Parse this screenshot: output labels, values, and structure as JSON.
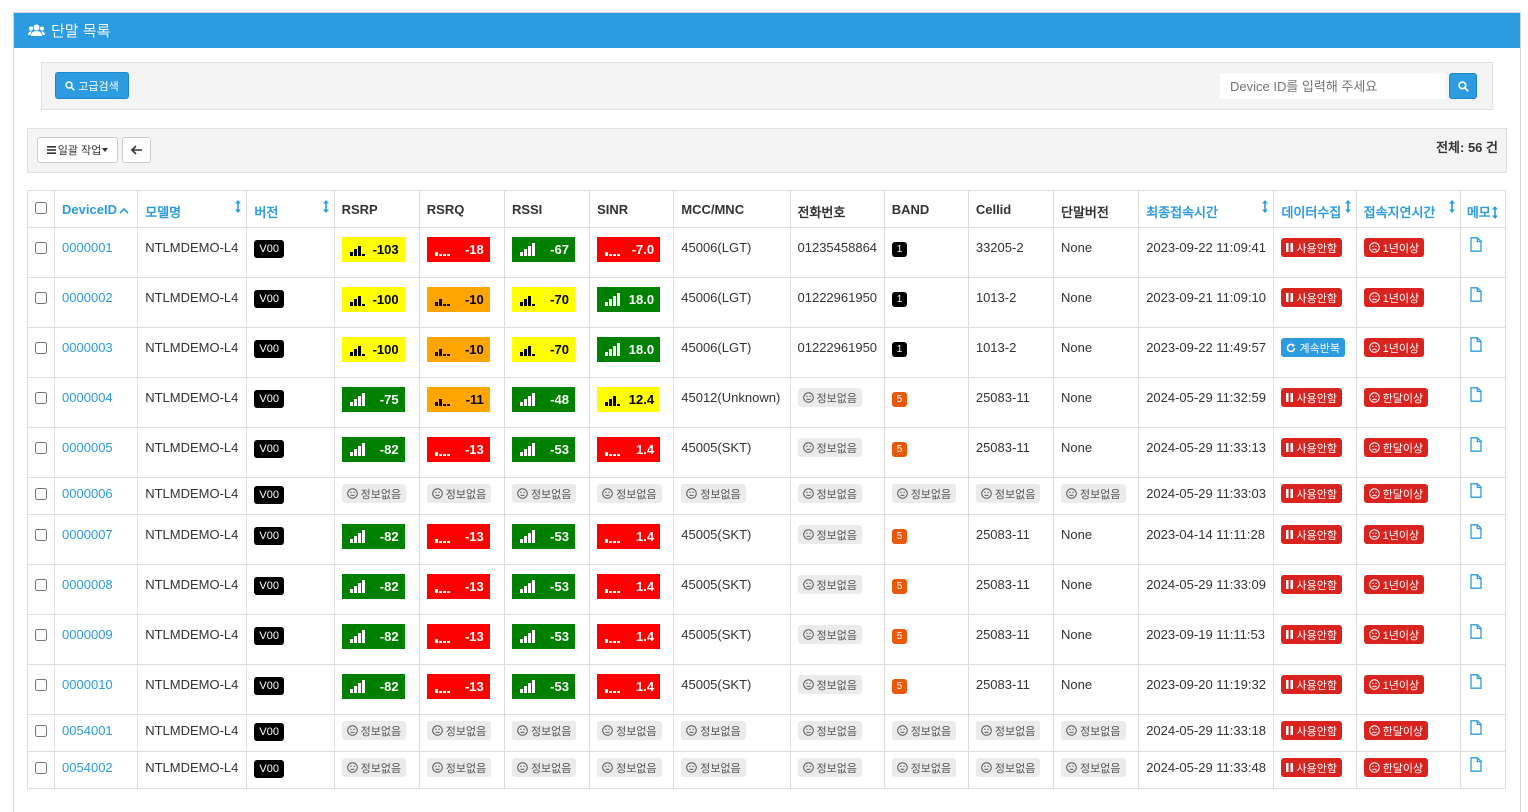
{
  "panel_title": "단말 목록",
  "search": {
    "advanced_label": "고급검색",
    "placeholder": "Device ID를 입력해 주세요"
  },
  "toolbar": {
    "bulk_label": "일괄 작업",
    "total_text": "전체: 56 건"
  },
  "columns": [
    "DeviceID",
    "모델명",
    "버전",
    "RSRP",
    "RSRQ",
    "RSSI",
    "SINR",
    "MCC/MNC",
    "전화번호",
    "BAND",
    "Cellid",
    "단말버전",
    "최종접속시간",
    "데이터수집",
    "접속지연시간",
    "메모"
  ],
  "no_info_label": "정보없음",
  "colors": {
    "header": "#2d9be0",
    "green": "#008000",
    "red": "#ff0000",
    "yellow": "#ffff00",
    "orange": "#ffa500",
    "label_red": "#d9231f"
  },
  "rows": [
    {
      "id": "0000001",
      "model": "NTLMDEMO-L4",
      "ver": "V00",
      "rsrp": {
        "v": "-103",
        "c": "yellow",
        "b": 3
      },
      "rsrq": {
        "v": "-18",
        "c": "red",
        "b": 1
      },
      "rssi": {
        "v": "-67",
        "c": "green",
        "b": 4
      },
      "sinr": {
        "v": "-7.0",
        "c": "red",
        "b": 1
      },
      "mcc": "45006(LGT)",
      "phone": "01235458864",
      "band": "1",
      "cellid": "33205-2",
      "fw": "None",
      "last": "2023-09-22 11:09:41",
      "collect": "사용안함",
      "collect_type": "pause",
      "delay": "1년이상"
    },
    {
      "id": "0000002",
      "model": "NTLMDEMO-L4",
      "ver": "V00",
      "rsrp": {
        "v": "-100",
        "c": "yellow",
        "b": 3
      },
      "rsrq": {
        "v": "-10",
        "c": "orange",
        "b": 2
      },
      "rssi": {
        "v": "-70",
        "c": "yellow",
        "b": 3
      },
      "sinr": {
        "v": "18.0",
        "c": "green",
        "b": 4
      },
      "mcc": "45006(LGT)",
      "phone": "01222961950",
      "band": "1",
      "cellid": "1013-2",
      "fw": "None",
      "last": "2023-09-21 11:09:10",
      "collect": "사용안함",
      "collect_type": "pause",
      "delay": "1년이상"
    },
    {
      "id": "0000003",
      "model": "NTLMDEMO-L4",
      "ver": "V00",
      "rsrp": {
        "v": "-100",
        "c": "yellow",
        "b": 3
      },
      "rsrq": {
        "v": "-10",
        "c": "orange",
        "b": 2
      },
      "rssi": {
        "v": "-70",
        "c": "yellow",
        "b": 3
      },
      "sinr": {
        "v": "18.0",
        "c": "green",
        "b": 4
      },
      "mcc": "45006(LGT)",
      "phone": "01222961950",
      "band": "1",
      "cellid": "1013-2",
      "fw": "None",
      "last": "2023-09-22 11:49:57",
      "collect": "계속반복",
      "collect_type": "repeat",
      "delay": "1년이상"
    },
    {
      "id": "0000004",
      "model": "NTLMDEMO-L4",
      "ver": "V00",
      "rsrp": {
        "v": "-75",
        "c": "green",
        "b": 4
      },
      "rsrq": {
        "v": "-11",
        "c": "orange",
        "b": 2
      },
      "rssi": {
        "v": "-48",
        "c": "green",
        "b": 4
      },
      "sinr": {
        "v": "12.4",
        "c": "yellow",
        "b": 3
      },
      "mcc": "45012(Unknown)",
      "phone": null,
      "band": "5",
      "cellid": "25083-11",
      "fw": "None",
      "last": "2024-05-29 11:32:59",
      "collect": "사용안함",
      "collect_type": "pause",
      "delay": "한달이상"
    },
    {
      "id": "0000005",
      "model": "NTLMDEMO-L4",
      "ver": "V00",
      "rsrp": {
        "v": "-82",
        "c": "green",
        "b": 4
      },
      "rsrq": {
        "v": "-13",
        "c": "red",
        "b": 1
      },
      "rssi": {
        "v": "-53",
        "c": "green",
        "b": 4
      },
      "sinr": {
        "v": "1.4",
        "c": "red",
        "b": 1
      },
      "mcc": "45005(SKT)",
      "phone": null,
      "band": "5",
      "cellid": "25083-11",
      "fw": "None",
      "last": "2024-05-29 11:33:13",
      "collect": "사용안함",
      "collect_type": "pause",
      "delay": "한달이상"
    },
    {
      "id": "0000006",
      "model": "NTLMDEMO-L4",
      "ver": "V00",
      "rsrp": null,
      "rsrq": null,
      "rssi": null,
      "sinr": null,
      "mcc": null,
      "phone": null,
      "band": null,
      "cellid": null,
      "fw": null,
      "last": "2024-05-29 11:33:03",
      "collect": "사용안함",
      "collect_type": "pause",
      "delay": "한달이상"
    },
    {
      "id": "0000007",
      "model": "NTLMDEMO-L4",
      "ver": "V00",
      "rsrp": {
        "v": "-82",
        "c": "green",
        "b": 4
      },
      "rsrq": {
        "v": "-13",
        "c": "red",
        "b": 1
      },
      "rssi": {
        "v": "-53",
        "c": "green",
        "b": 4
      },
      "sinr": {
        "v": "1.4",
        "c": "red",
        "b": 1
      },
      "mcc": "45005(SKT)",
      "phone": null,
      "band": "5",
      "cellid": "25083-11",
      "fw": "None",
      "last": "2023-04-14 11:11:28",
      "collect": "사용안함",
      "collect_type": "pause",
      "delay": "1년이상"
    },
    {
      "id": "0000008",
      "model": "NTLMDEMO-L4",
      "ver": "V00",
      "rsrp": {
        "v": "-82",
        "c": "green",
        "b": 4
      },
      "rsrq": {
        "v": "-13",
        "c": "red",
        "b": 1
      },
      "rssi": {
        "v": "-53",
        "c": "green",
        "b": 4
      },
      "sinr": {
        "v": "1.4",
        "c": "red",
        "b": 1
      },
      "mcc": "45005(SKT)",
      "phone": null,
      "band": "5",
      "cellid": "25083-11",
      "fw": "None",
      "last": "2024-05-29 11:33:09",
      "collect": "사용안함",
      "collect_type": "pause",
      "delay": "1년이상"
    },
    {
      "id": "0000009",
      "model": "NTLMDEMO-L4",
      "ver": "V00",
      "rsrp": {
        "v": "-82",
        "c": "green",
        "b": 4
      },
      "rsrq": {
        "v": "-13",
        "c": "red",
        "b": 1
      },
      "rssi": {
        "v": "-53",
        "c": "green",
        "b": 4
      },
      "sinr": {
        "v": "1.4",
        "c": "red",
        "b": 1
      },
      "mcc": "45005(SKT)",
      "phone": null,
      "band": "5",
      "cellid": "25083-11",
      "fw": "None",
      "last": "2023-09-19 11:11:53",
      "collect": "사용안함",
      "collect_type": "pause",
      "delay": "1년이상"
    },
    {
      "id": "0000010",
      "model": "NTLMDEMO-L4",
      "ver": "V00",
      "rsrp": {
        "v": "-82",
        "c": "green",
        "b": 4
      },
      "rsrq": {
        "v": "-13",
        "c": "red",
        "b": 1
      },
      "rssi": {
        "v": "-53",
        "c": "green",
        "b": 4
      },
      "sinr": {
        "v": "1.4",
        "c": "red",
        "b": 1
      },
      "mcc": "45005(SKT)",
      "phone": null,
      "band": "5",
      "cellid": "25083-11",
      "fw": "None",
      "last": "2023-09-20 11:19:32",
      "collect": "사용안함",
      "collect_type": "pause",
      "delay": "1년이상"
    },
    {
      "id": "0054001",
      "model": "NTLMDEMO-L4",
      "ver": "V00",
      "rsrp": null,
      "rsrq": null,
      "rssi": null,
      "sinr": null,
      "mcc": null,
      "phone": null,
      "band": null,
      "cellid": null,
      "fw": null,
      "last": "2024-05-29 11:33:18",
      "collect": "사용안함",
      "collect_type": "pause",
      "delay": "한달이상"
    },
    {
      "id": "0054002",
      "model": "NTLMDEMO-L4",
      "ver": "V00",
      "rsrp": null,
      "rsrq": null,
      "rssi": null,
      "sinr": null,
      "mcc": null,
      "phone": null,
      "band": null,
      "cellid": null,
      "fw": null,
      "last": "2024-05-29 11:33:48",
      "collect": "사용안함",
      "collect_type": "pause",
      "delay": "한달이상"
    }
  ]
}
